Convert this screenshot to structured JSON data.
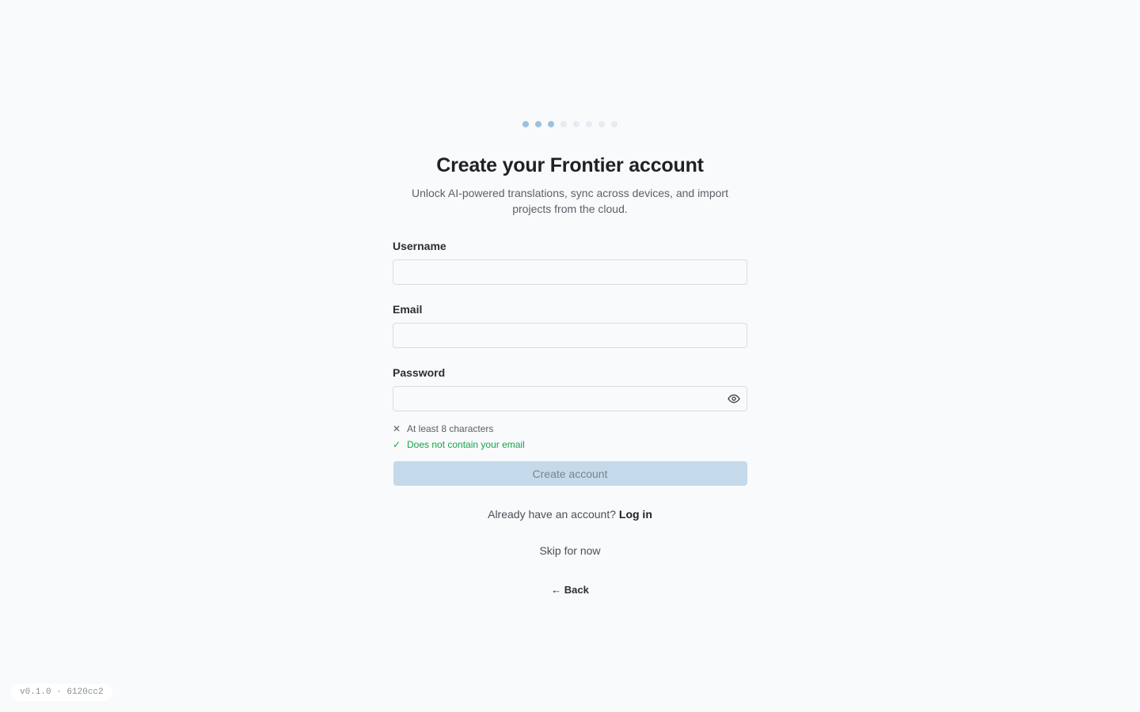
{
  "stepper": {
    "total_steps": 8,
    "completed_steps": 3
  },
  "header": {
    "title": "Create your Frontier account",
    "subtitle": "Unlock AI-powered translations, sync across devices, and import projects from the cloud."
  },
  "form": {
    "username": {
      "label": "Username",
      "value": "",
      "placeholder": ""
    },
    "email": {
      "label": "Email",
      "value": "",
      "placeholder": ""
    },
    "password": {
      "label": "Password",
      "value": "",
      "placeholder": "",
      "toggle_icon": "eye-icon"
    },
    "rules": [
      {
        "text": "At least 8 characters",
        "status": "fail",
        "icon": "x-icon"
      },
      {
        "text": "Does not contain your email",
        "status": "pass",
        "icon": "check-icon"
      }
    ],
    "submit_label": "Create account"
  },
  "login": {
    "prompt": "Already have an account?",
    "link_label": "Log in"
  },
  "skip_label": "Skip for now",
  "back_label": "← Back",
  "version": "v0.1.0 · 6120cc2",
  "colors": {
    "background": "#f8fafc",
    "step_done": "#9fc0db",
    "step_pending": "#e6ebf1",
    "button_disabled_bg": "#c4d9e9",
    "rule_pass": "#16a34a"
  }
}
